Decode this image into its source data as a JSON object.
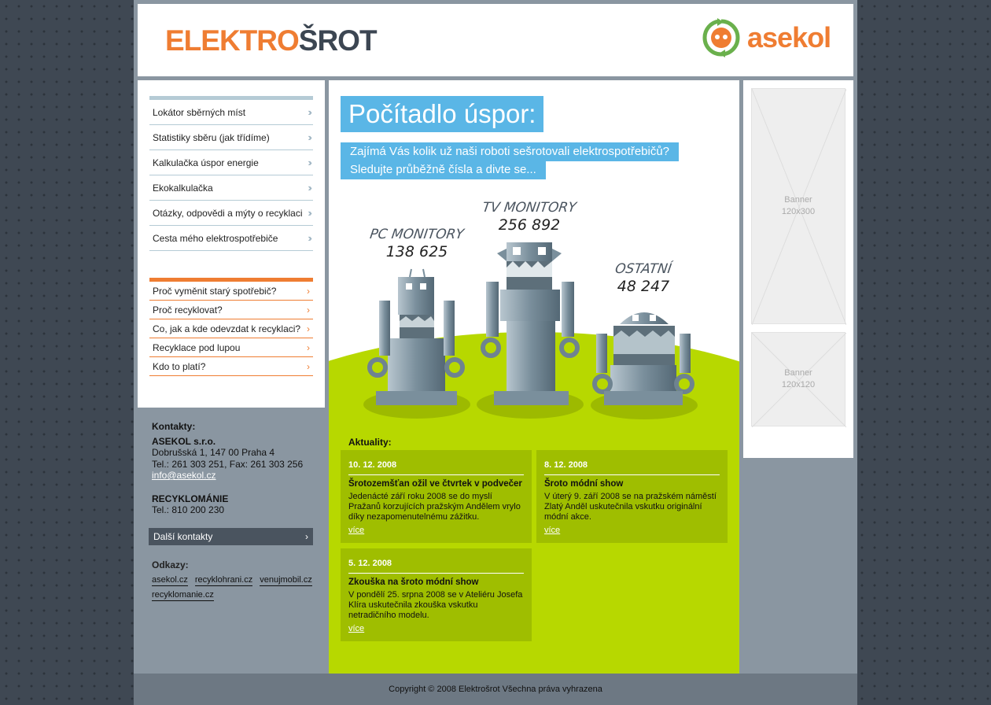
{
  "header": {
    "logo_part1": "ELEKTRO",
    "logo_part2": "ŠROT",
    "partner_logo": "asekol"
  },
  "menu_main": [
    "Lokátor sběrných míst",
    "Statistiky sběru (jak třídíme)",
    "Kalkulačka úspor energie",
    "Ekokalkulačka",
    "Otázky, odpovědi a mýty o recyklaci",
    "Cesta mého elektrospotřebiče"
  ],
  "menu_secondary": [
    "Proč vyměnit starý spotřebič?",
    "Proč recyklovat?",
    "Co, jak a kde odevzdat k recyklaci?",
    "Recyklace pod lupou",
    "Kdo to platí?"
  ],
  "contacts": {
    "heading": "Kontakty:",
    "company": "ASEKOL s.r.o.",
    "address": "Dobrušská 1, 147 00  Praha 4",
    "phone": "Tel.: 261 303 251, Fax: 261 303 256",
    "email": "info@asekol.cz",
    "org2": "RECYKLOMÁNIE",
    "org2_phone": "Tel.: 810 200 230",
    "more_button": "Další kontakty"
  },
  "links": {
    "heading": "Odkazy:",
    "items": [
      "asekol.cz",
      "recyklohrani.cz",
      "venujmobil.cz",
      "recyklomanie.cz"
    ]
  },
  "counter": {
    "title": "Počítadlo úspor:",
    "subtitle1": "Zajímá Vás kolik už naši roboti sešrotovali elektrospotřebičů?",
    "subtitle2": "Sledujte průběžně čísla a divte se...",
    "robots": [
      {
        "name": "PC MONITORY",
        "value": "138 625"
      },
      {
        "name": "TV MONITORY",
        "value": "256 892"
      },
      {
        "name": "OSTATNÍ",
        "value": "48 247"
      }
    ]
  },
  "news": {
    "heading": "Aktuality:",
    "items": [
      {
        "date": "10. 12. 2008",
        "title": "Šrotozemšťan ožil ve čtvrtek v podvečer",
        "text": "Jedenácté září roku 2008 se do myslí Pražanů korzujících pražským Andělem vrylo díky nezapomenutelnému zážitku.",
        "more": "více"
      },
      {
        "date": "8. 12. 2008",
        "title": "Šroto módní show",
        "text": "V úterý 9. září 2008 se na pražském náměstí Zlatý Anděl uskutečnila vskutku originální módní akce.",
        "more": "více"
      },
      {
        "date": "5. 12. 2008",
        "title": "Zkouška na šroto módní show",
        "text": "V pondělí 25. srpna 2008 se v Ateliéru Josefa Klíra uskutečnila zkouška vskutku netradičního modelu.",
        "more": "více"
      }
    ]
  },
  "banners": [
    {
      "label": "Banner",
      "size": "120x300"
    },
    {
      "label": "Banner",
      "size": "120x120"
    }
  ],
  "footer": {
    "copyright": "Copyright © 2008 Elektrošrot Všechna práva vyhrazena"
  },
  "colors": {
    "orange": "#ef7d32",
    "blue": "#5ab6e6",
    "green": "#b7d800",
    "dark": "#3c4652"
  }
}
